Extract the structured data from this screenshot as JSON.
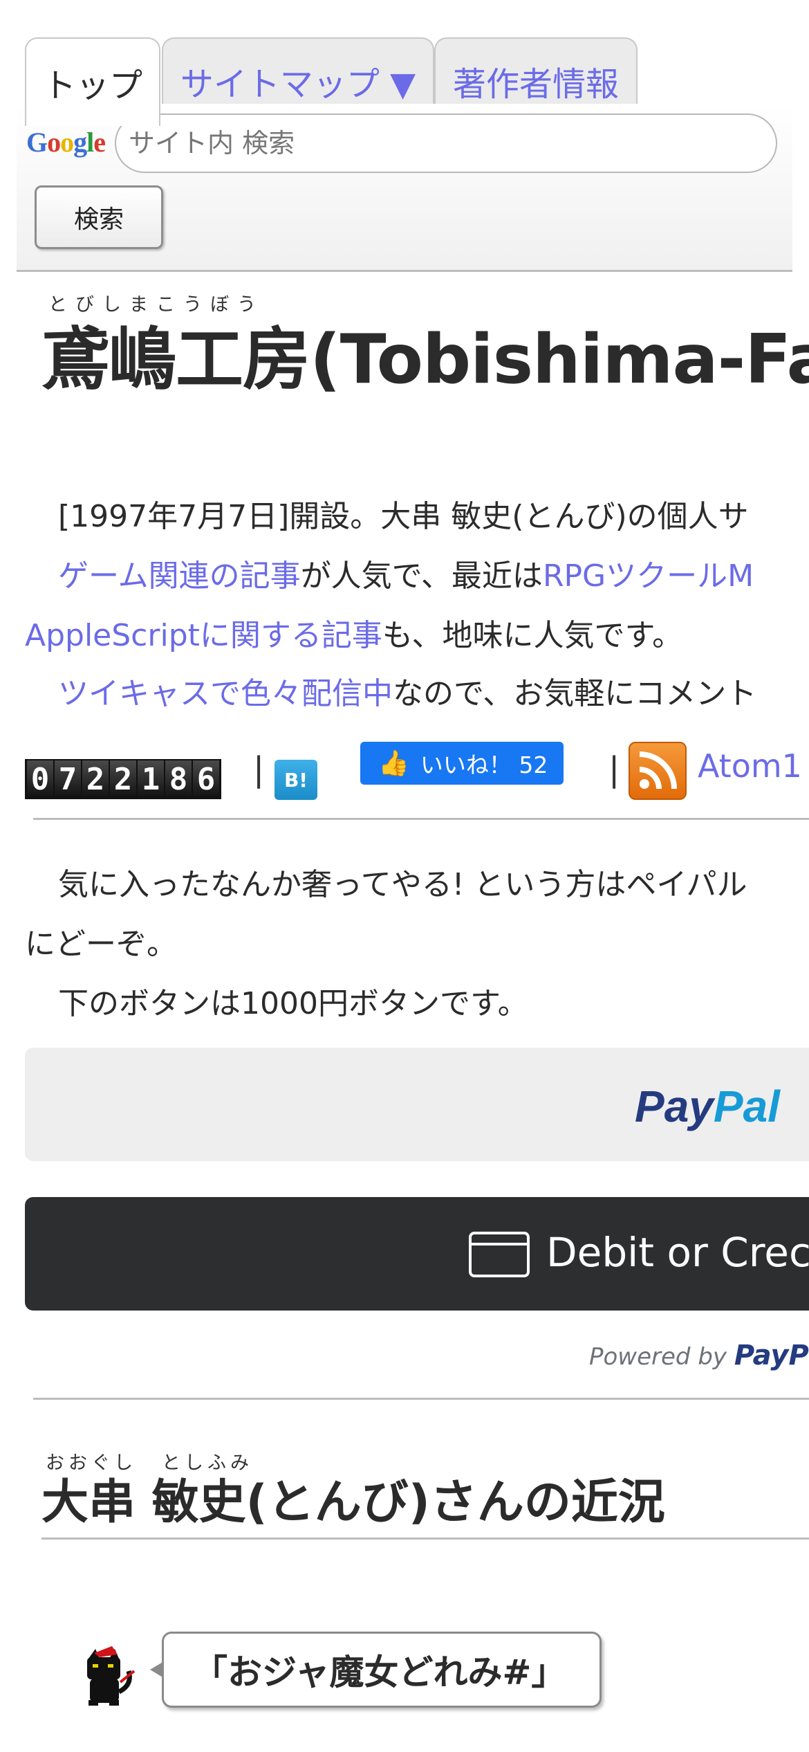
{
  "tabs": [
    {
      "label": "トップ"
    },
    {
      "label": "サイトマップ ▼"
    },
    {
      "label": "著作者情報"
    }
  ],
  "search": {
    "logo_text": "Google",
    "placeholder": "サイト内 検索",
    "button_label": "検索"
  },
  "title": {
    "ruby": "とびしまこうぼう",
    "text": "鳶嶋工房(Tobishima-Fa"
  },
  "intro": {
    "line1": "[1997年7月7日]開設。大串 敏史(とんび)の個人サ",
    "line2_link1": "ゲーム関連の記事",
    "line2_text": "が人気で、最近は",
    "line2_link2": "RPGツクールM",
    "line3_link": "AppleScriptに関する記事",
    "line3_text": "も、地味に人気です。",
    "line4_link": "ツイキャスで色々配信中",
    "line4_text": "なので、お気軽にコメント"
  },
  "share": {
    "counter_digits": [
      "0",
      "7",
      "2",
      "2",
      "1",
      "8",
      "6"
    ],
    "separator": "|",
    "hatena_label": "B!",
    "like_label": "いいね！ 52",
    "atom_label": "Atom1"
  },
  "donate": {
    "line1": "気に入ったなんか奢ってやる! という方はペイパル",
    "line2": "にどーぞ。",
    "line3": "下のボタンは1000円ボタンです。",
    "paypal_pay": "Pay",
    "paypal_pal": "Pal",
    "debit_label": "Debit or Crec",
    "powered_by": "Powered by",
    "powered_brand": "PayP"
  },
  "section": {
    "ruby_family": "おおぐし",
    "ruby_given": "としふみ",
    "title": "大串 敏史(とんび)さんの近況"
  },
  "status": {
    "bubble_text": "「おジャ魔女どれみ#」"
  },
  "colors": {
    "link": "#6b6be8",
    "facebook": "#1877f2",
    "paypal_dark": "#253b80",
    "paypal_light": "#179bd7",
    "rss": "#f08a24"
  }
}
